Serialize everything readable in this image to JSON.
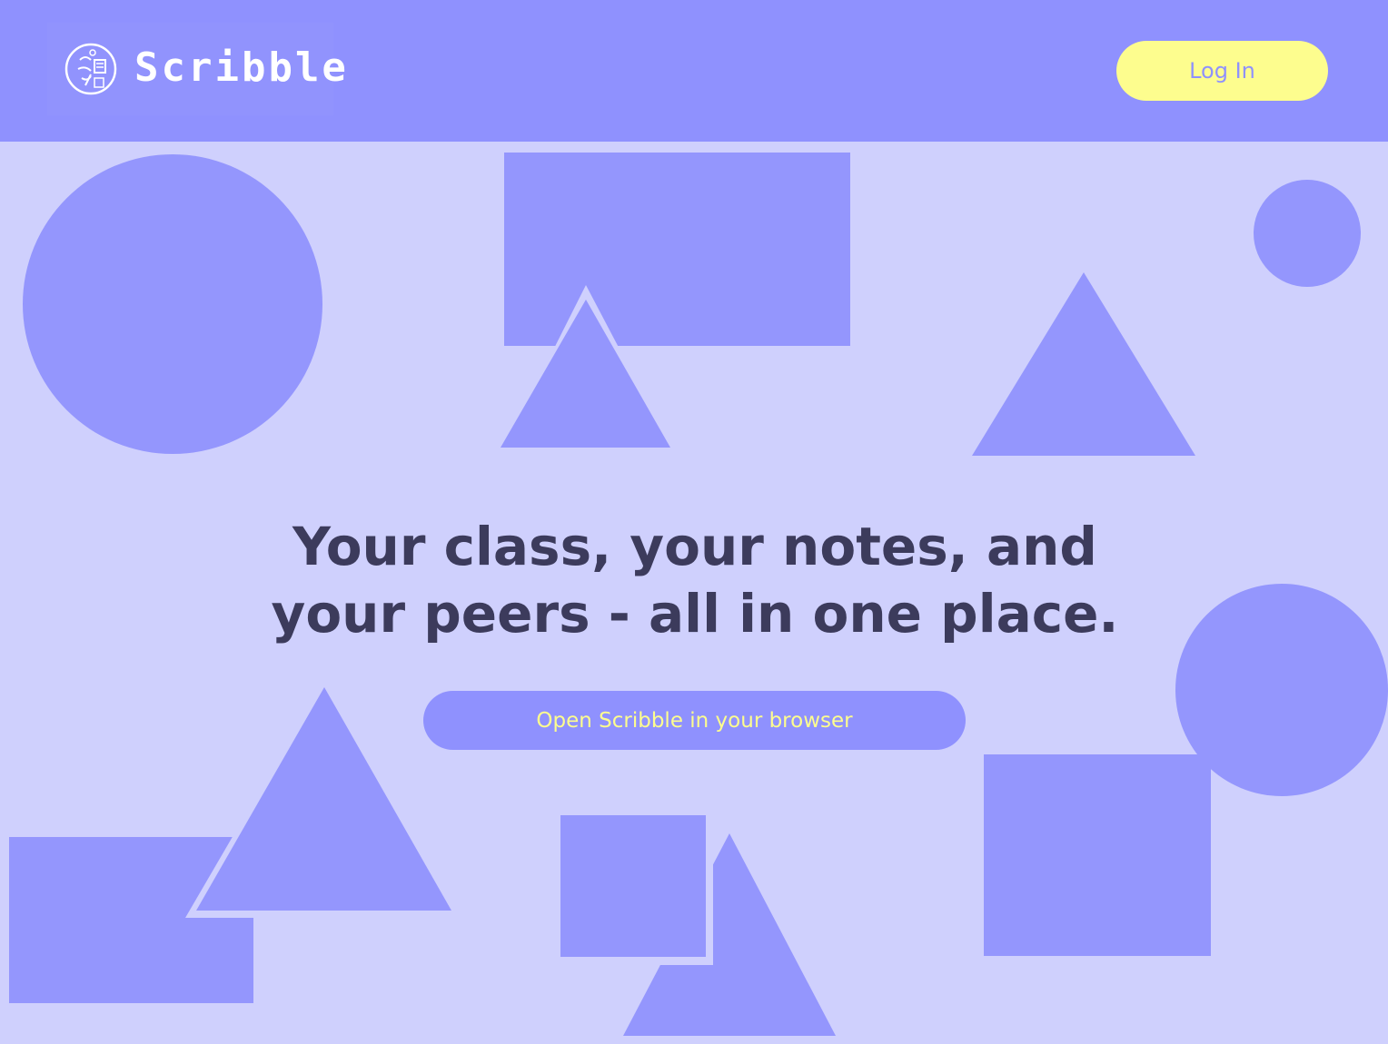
{
  "header": {
    "brand_name": "Scribble",
    "login_label": "Log In"
  },
  "hero": {
    "headline_line1": "Your class, your notes, and",
    "headline_line2": "your peers - all in one place.",
    "cta_label": "Open Scribble in your browser"
  },
  "colors": {
    "header_bg": "#8f91fe",
    "page_bg": "#cfd0fd",
    "shape_fill": "#9496fd",
    "accent_yellow": "#fdfd8e",
    "headline_text": "#3c3b5c"
  },
  "icons": {
    "logo": "brain-circuit-icon"
  }
}
